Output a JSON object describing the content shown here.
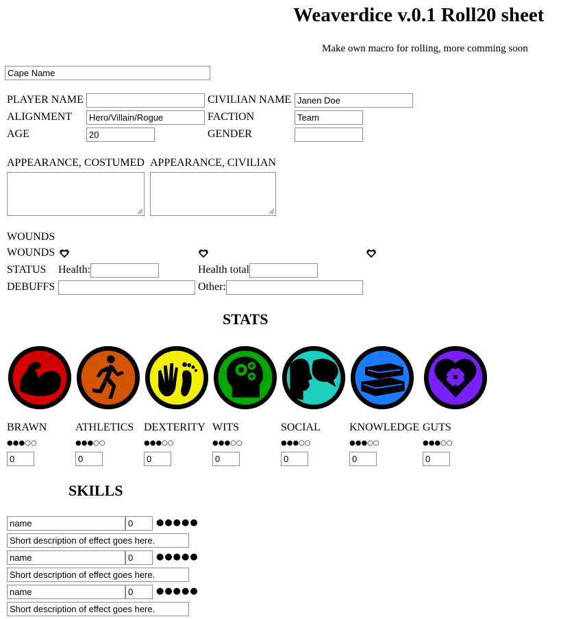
{
  "header": {
    "title": "Weaverdice v.0.1 Roll20 sheet",
    "subtitle": "Make own macro for rolling, more comming soon"
  },
  "cape_name": {
    "value": "Cape Name"
  },
  "identity": {
    "player_name_label": "PLAYER NAME",
    "player_name_value": "",
    "civilian_name_label": "CIVILIAN NAME",
    "civilian_name_value": "Janen Doe",
    "alignment_label": "ALIGNMENT",
    "alignment_value": "Hero/Villain/Rogue",
    "faction_label": "FACTION",
    "faction_value": "Team",
    "age_label": "AGE",
    "age_value": "20",
    "gender_label": "GENDER",
    "gender_value": ""
  },
  "appearance": {
    "costumed_label": "APPEARANCE, COSTUMED",
    "civilian_label": "APPEARANCE, CIVILIAN"
  },
  "wounds": {
    "heading": "WOUNDS",
    "row_label": "WOUNDS",
    "status_label": "STATUS",
    "health_label": "Health:",
    "health_value": "",
    "health_total_label": "Health total",
    "health_total_value": "",
    "debuffs_label": "DEBUFFS",
    "debuffs_value": "",
    "other_label": "Other:",
    "other_value": ""
  },
  "stats": {
    "heading": "STATS",
    "items": [
      {
        "label": "BRAWN",
        "dots": "●●●○○",
        "value": "0",
        "color": "#d40000",
        "icon": "flexed-arm-icon"
      },
      {
        "label": "ATHLETICS",
        "dots": "●●●○○",
        "value": "0",
        "color": "#d45500",
        "icon": "runner-icon"
      },
      {
        "label": "DEXTERITY",
        "dots": "●●●○○",
        "value": "0",
        "color": "#f2f200",
        "icon": "hand-foot-icon"
      },
      {
        "label": "WITS",
        "dots": "●●●○○",
        "value": "0",
        "color": "#00a800",
        "icon": "gear-head-icon"
      },
      {
        "label": "SOCIAL",
        "dots": "●●●○○",
        "value": "0",
        "color": "#1ecfbf",
        "icon": "speech-head-icon"
      },
      {
        "label": "KNOWLEDGE",
        "dots": "●●●○○",
        "value": "0",
        "color": "#1c7cff",
        "icon": "books-icon"
      },
      {
        "label": "GUTS",
        "dots": "●●●○○",
        "value": "0",
        "color": "#7a1fff",
        "icon": "bandaged-heart-icon"
      }
    ]
  },
  "skills": {
    "heading": "SKILLS",
    "items": [
      {
        "name": "name",
        "value": "0",
        "dots": "●●●●●",
        "description": "Short description of effect goes here."
      },
      {
        "name": "name",
        "value": "0",
        "dots": "●●●●●",
        "description": "Short description of effect goes here."
      },
      {
        "name": "name",
        "value": "0",
        "dots": "●●●●●",
        "description": "Short description of effect goes here."
      }
    ]
  }
}
